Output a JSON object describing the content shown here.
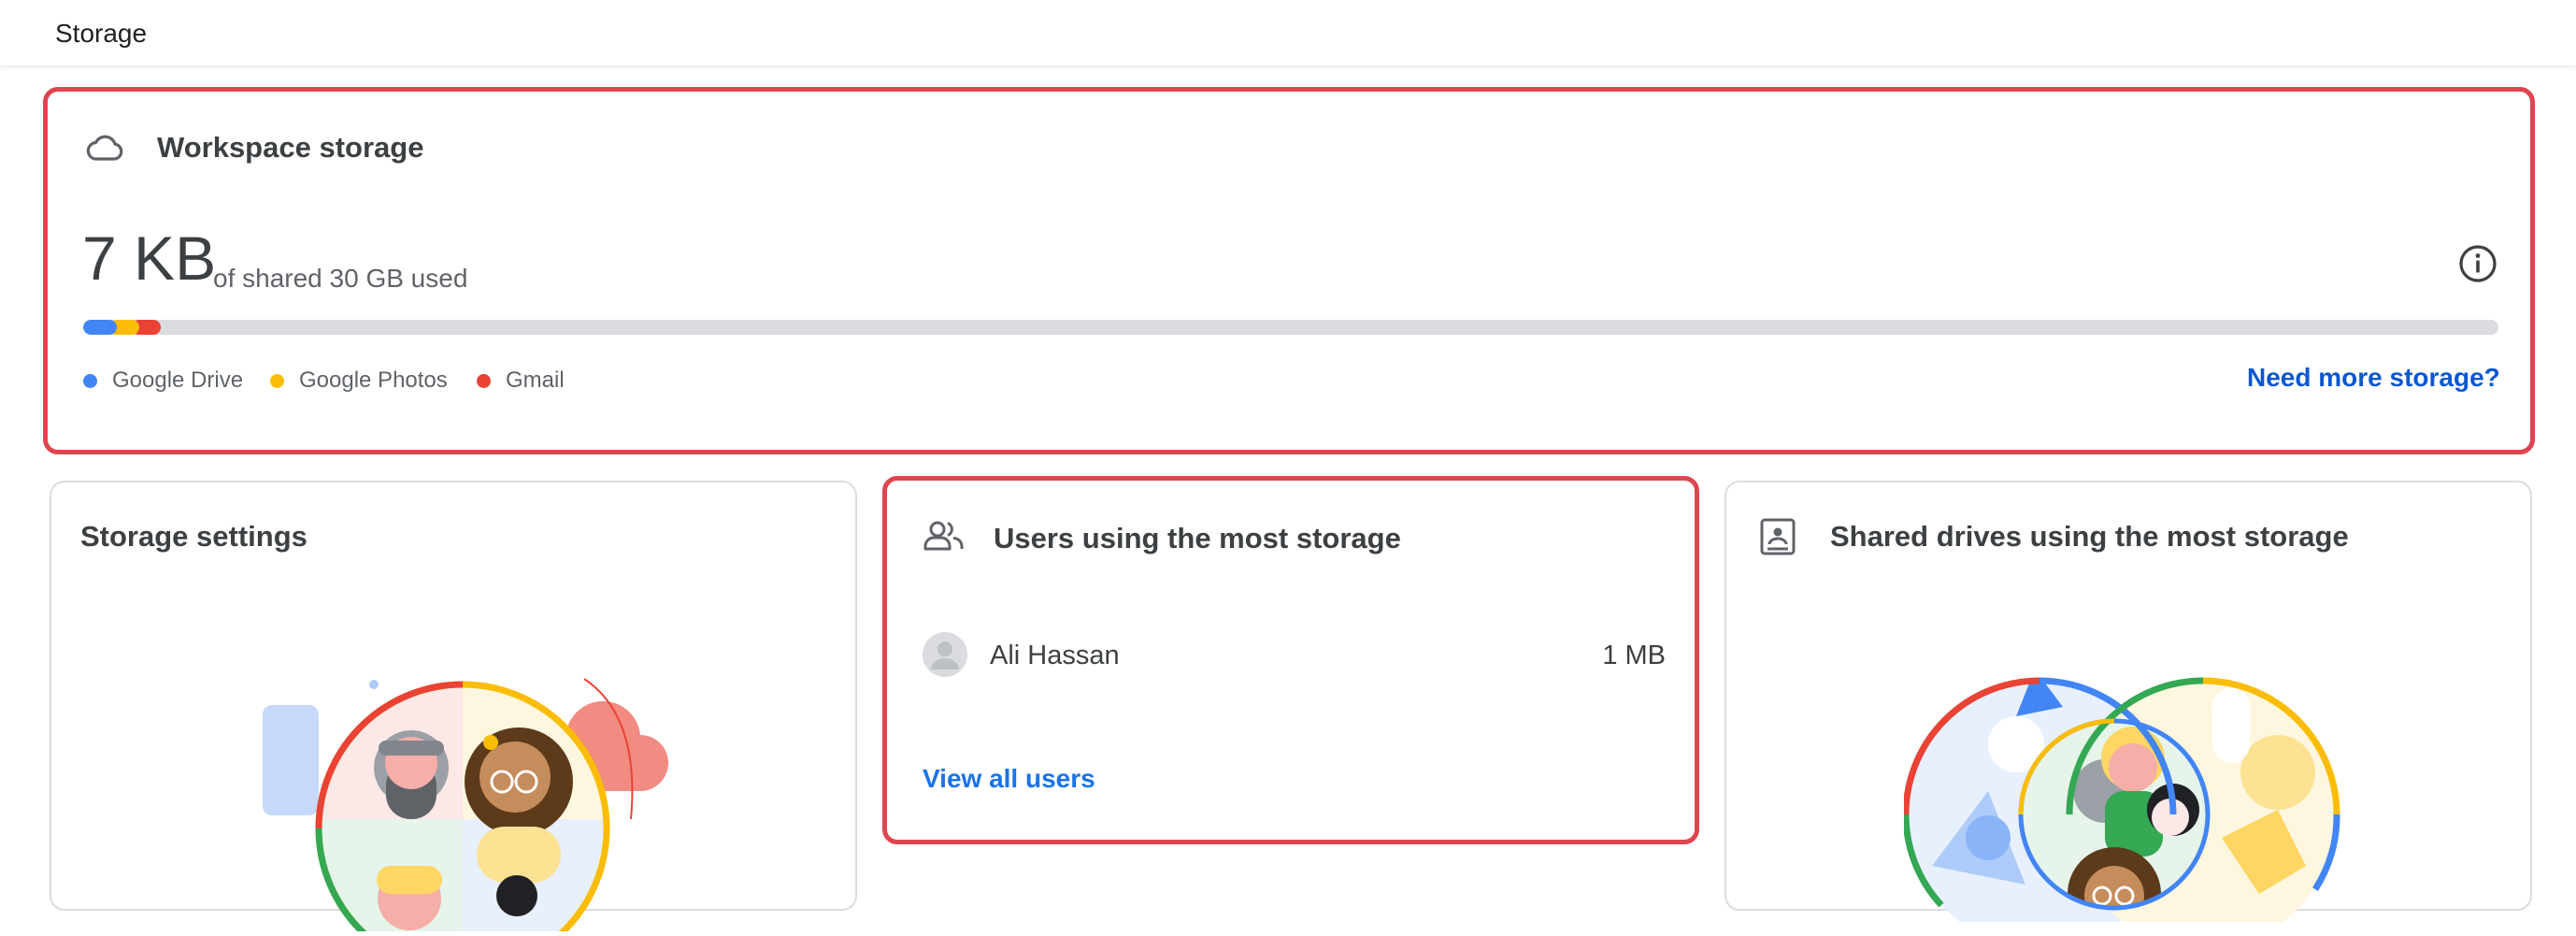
{
  "page": {
    "title": "Storage"
  },
  "workspace": {
    "title": "Workspace storage",
    "used": "7 KB",
    "of_label": "of shared 30 GB used",
    "need_more": "Need more storage?",
    "segments": [
      {
        "label": "Google Drive",
        "color": "#4285f4",
        "share": 0.011
      },
      {
        "label": "Google Photos",
        "color": "#fbbc04",
        "share": 0.009
      },
      {
        "label": "Gmail",
        "color": "#ea4335",
        "share": 0.009
      }
    ]
  },
  "settings": {
    "title": "Storage settings"
  },
  "users": {
    "title": "Users using the most storage",
    "rows": [
      {
        "name": "Ali Hassan",
        "size": "1 MB"
      }
    ],
    "view_all": "View all users"
  },
  "drives": {
    "title": "Shared drives using the most storage"
  },
  "colors": {
    "highlight": "#e0454f",
    "link": "#1a73e8",
    "link_dark": "#0b57d0"
  },
  "icons": {
    "workspace": "cloud-icon",
    "info": "info-icon",
    "users": "people-icon",
    "drives": "shared-drive-icon"
  }
}
